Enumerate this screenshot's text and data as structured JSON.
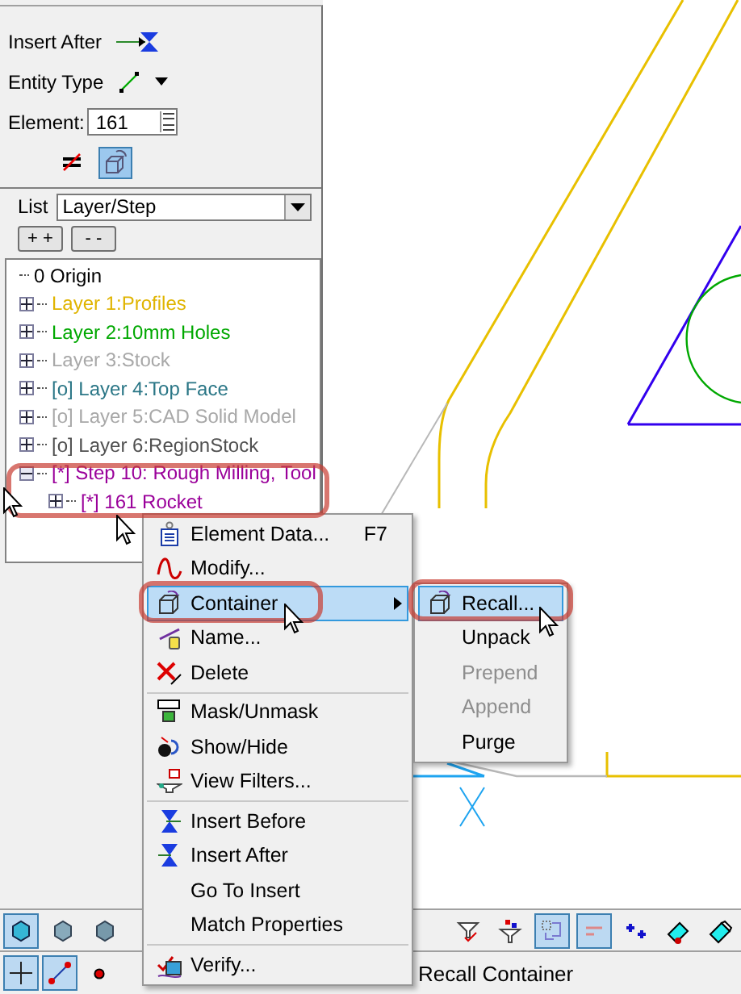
{
  "panel": {
    "insert_label": "Insert After",
    "entity_type_label": "Entity Type",
    "element_label": "Element:",
    "element_value": "161",
    "toggle_buttons": [
      {
        "selected": false
      },
      {
        "selected": true
      }
    ],
    "list_label": "List",
    "list_value": "Layer/Step",
    "expand_all": "+ +",
    "collapse_all": "- -"
  },
  "tree": [
    {
      "label": "0 Origin",
      "kind": "leaf",
      "color": "#000000"
    },
    {
      "label": "Layer 1:Profiles",
      "kind": "folder",
      "expanded": false,
      "color": "#e0b400"
    },
    {
      "label": "Layer 2:10mm Holes",
      "kind": "folder",
      "expanded": false,
      "color": "#00a800"
    },
    {
      "label": "Layer 3:Stock",
      "kind": "folder",
      "expanded": false,
      "color": "#a8a8a8"
    },
    {
      "label": "[o] Layer 4:Top Face",
      "kind": "folder",
      "expanded": false,
      "color": "#2a7686"
    },
    {
      "label": "[o] Layer 5:CAD Solid Model",
      "kind": "folder",
      "expanded": false,
      "color": "#a8a8a8"
    },
    {
      "label": "[o] Layer 6:RegionStock",
      "kind": "folder",
      "expanded": false,
      "color": "#505050"
    },
    {
      "label": "[*] Step 10: Rough Milling, Tool",
      "kind": "folder",
      "expanded": true,
      "color": "#9a009a",
      "children": [
        {
          "label": "[*] 161 Rocket",
          "kind": "folder",
          "expanded": false,
          "color": "#9a009a"
        }
      ]
    }
  ],
  "context_menu": {
    "items": [
      {
        "kind": "item",
        "label": "Element Data...",
        "shortcut": "F7",
        "selected": false,
        "disabled": false
      },
      {
        "kind": "item",
        "label": "Modify...",
        "selected": false,
        "disabled": false
      },
      {
        "kind": "submenu",
        "label": "Container",
        "selected": true,
        "disabled": false
      },
      {
        "kind": "item",
        "label": "Name...",
        "selected": false,
        "disabled": false
      },
      {
        "kind": "item",
        "label": "Delete",
        "selected": false,
        "disabled": false
      },
      {
        "kind": "separator"
      },
      {
        "kind": "item",
        "label": "Mask/Unmask",
        "selected": false,
        "disabled": false
      },
      {
        "kind": "item",
        "label": "Show/Hide",
        "selected": false,
        "disabled": false
      },
      {
        "kind": "item",
        "label": "View Filters...",
        "selected": false,
        "disabled": false
      },
      {
        "kind": "separator"
      },
      {
        "kind": "item",
        "label": "Insert Before",
        "selected": false,
        "disabled": false
      },
      {
        "kind": "item",
        "label": "Insert After",
        "selected": false,
        "disabled": false
      },
      {
        "kind": "item",
        "label": "Go To Insert",
        "selected": false,
        "disabled": false
      },
      {
        "kind": "item",
        "label": "Match Properties",
        "selected": false,
        "disabled": false
      },
      {
        "kind": "separator"
      },
      {
        "kind": "item",
        "label": "Verify...",
        "selected": false,
        "disabled": false
      }
    ]
  },
  "submenu": {
    "items": [
      {
        "label": "Recall...",
        "selected": true,
        "disabled": false
      },
      {
        "label": "Unpack",
        "selected": false,
        "disabled": false
      },
      {
        "label": "Prepend",
        "selected": false,
        "disabled": true
      },
      {
        "label": "Append",
        "selected": false,
        "disabled": true
      },
      {
        "label": "Purge",
        "selected": false,
        "disabled": false
      }
    ]
  },
  "bottom_toolbar": {
    "left_buttons": [
      {
        "selected": true
      },
      {
        "selected": false
      },
      {
        "selected": false
      }
    ],
    "right_buttons": [
      {
        "selected": false
      },
      {
        "selected": false
      },
      {
        "selected": true
      },
      {
        "selected": true
      },
      {
        "selected": false
      },
      {
        "selected": false
      },
      {
        "selected": false
      }
    ]
  },
  "status_bar": {
    "mode_buttons": [
      {
        "selected": true
      },
      {
        "selected": true
      },
      {
        "selected": false
      }
    ],
    "message": "Recall Container"
  }
}
